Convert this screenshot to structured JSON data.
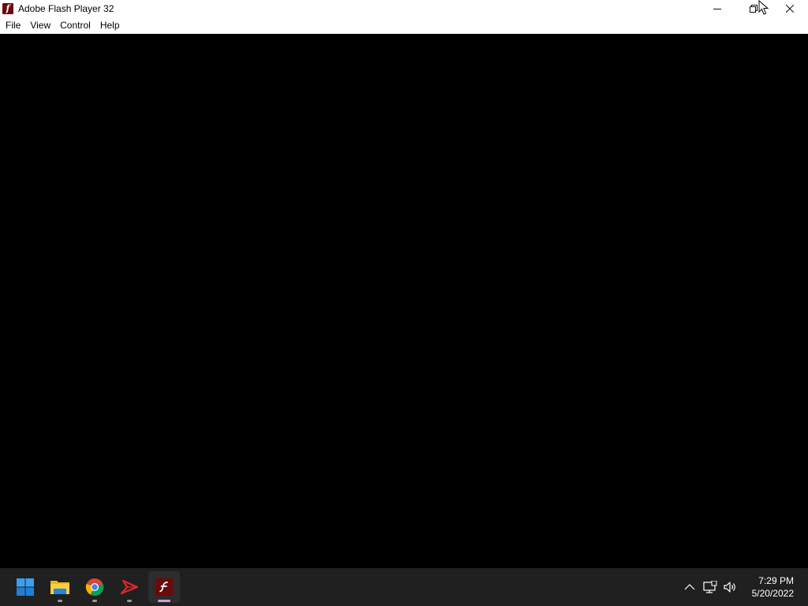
{
  "window": {
    "title": "Adobe Flash Player 32",
    "app_icon": "flash-player-icon",
    "controls": [
      "minimize-icon",
      "restore-icon",
      "close-icon"
    ]
  },
  "menu": {
    "items": [
      "File",
      "View",
      "Control",
      "Help"
    ]
  },
  "stage": {
    "background": "#000000"
  },
  "taskbar": {
    "background": "#202020",
    "apps": [
      {
        "name": "start",
        "icon": "windows-start-icon"
      },
      {
        "name": "file-explorer",
        "icon": "folder-icon"
      },
      {
        "name": "chrome",
        "icon": "chrome-icon"
      },
      {
        "name": "acrobat",
        "icon": "acrobat-icon"
      },
      {
        "name": "flash-player",
        "icon": "flash-player-icon",
        "active": true
      }
    ],
    "tray": {
      "icons": [
        "chevron-up-icon",
        "network-icon",
        "volume-icon"
      ],
      "time": "7:29 PM",
      "date": "5/20/2022"
    }
  },
  "colors": {
    "flash_red": "#6b0a0a",
    "active_indicator": "#c9a0dc"
  }
}
